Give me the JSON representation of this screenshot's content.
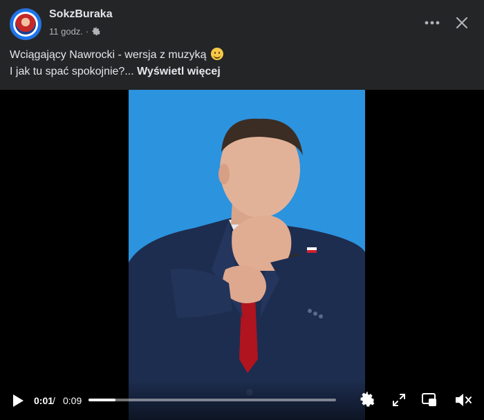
{
  "post": {
    "author": "SokzBuraka",
    "time": "11 godz.",
    "time_separator": "·",
    "caption_line1": "Wciągający Nawrocki - wersja z muzyką",
    "caption_line2": "I jak tu spać spokojnie?...",
    "see_more": "Wyświetl więcej",
    "emoji_icon": "slightly-smiling-face-icon",
    "privacy_icon": "gear-icon"
  },
  "header_actions": {
    "more_icon": "more-options-icon",
    "close_icon": "close-icon"
  },
  "video": {
    "current_time": "0:01",
    "separator": "/",
    "duration": "0:09",
    "progress_fraction": 0.11,
    "background_color": "#2c93de",
    "controls": [
      "play-icon",
      "settings-icon",
      "fullscreen-icon",
      "picture-in-picture-icon",
      "volume-muted-icon"
    ]
  },
  "colors": {
    "surface": "#242526",
    "text_primary": "#e4e6eb",
    "text_secondary": "#b0b3b8",
    "video_bg": "#000000"
  }
}
